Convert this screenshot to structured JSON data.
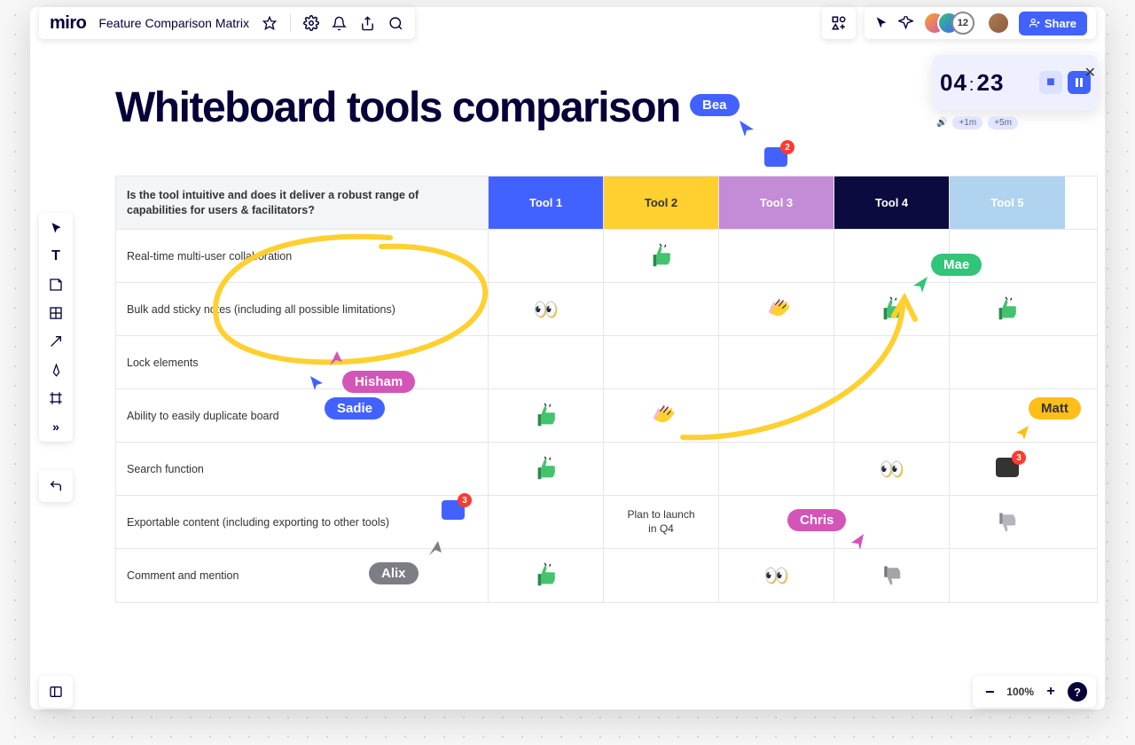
{
  "header": {
    "logo": "miro",
    "board_name": "Feature Comparison Matrix"
  },
  "share_label": "Share",
  "user_overflow": "12",
  "timer": {
    "mm": "04",
    "ss": "23",
    "add1": "+1m",
    "add5": "+5m"
  },
  "canvas": {
    "title": "Whiteboard tools comparison"
  },
  "table": {
    "question": "Is the tool intuitive and does it deliver a robust range of capabilities for users & facilitators?",
    "tools": [
      "Tool 1",
      "Tool 2",
      "Tool 3",
      "Tool 4",
      "Tool 5"
    ],
    "tool_colors": [
      "#4262ff",
      "#ffd02f",
      "#c48bd6",
      "#0c0b3f",
      "#b0d3ef"
    ],
    "rows": [
      {
        "label": "Real-time multi-user collaboration",
        "cells": [
          "",
          "thumb",
          "",
          "",
          ""
        ]
      },
      {
        "label": "Bulk add sticky notes (including all possible limitations)",
        "cells": [
          "eyes",
          "",
          "clap",
          "thumb",
          "thumb"
        ]
      },
      {
        "label": "Lock elements",
        "cells": [
          "",
          "",
          "",
          "",
          ""
        ]
      },
      {
        "label": "Ability to easily duplicate board",
        "cells": [
          "thumb",
          "clap",
          "",
          "",
          ""
        ]
      },
      {
        "label": "Search function",
        "cells": [
          "thumb",
          "",
          "",
          "eyes",
          "comment3"
        ]
      },
      {
        "label": "Exportable content (including exporting to other tools)",
        "cells": [
          "",
          "Plan to launch in Q4",
          "",
          "",
          "thumbdn"
        ]
      },
      {
        "label": "Comment and mention",
        "cells": [
          "thumb",
          "",
          "eyes",
          "thumbdn_g",
          ""
        ]
      }
    ]
  },
  "cursors": {
    "bea": {
      "label": "Bea",
      "color": "#4262ff"
    },
    "mae": {
      "label": "Mae",
      "color": "#31c57a"
    },
    "hisham": {
      "label": "Hisham",
      "color": "#d455b8"
    },
    "sadie": {
      "label": "Sadie",
      "color": "#4262ff"
    },
    "matt": {
      "label": "Matt",
      "color": "#ffbe18"
    },
    "chris": {
      "label": "Chris",
      "color": "#d455b8"
    },
    "alix": {
      "label": "Alix",
      "color": "#7d7d85"
    }
  },
  "comments": {
    "top": "2",
    "mid": "3",
    "right": "3"
  },
  "zoom": "100%"
}
